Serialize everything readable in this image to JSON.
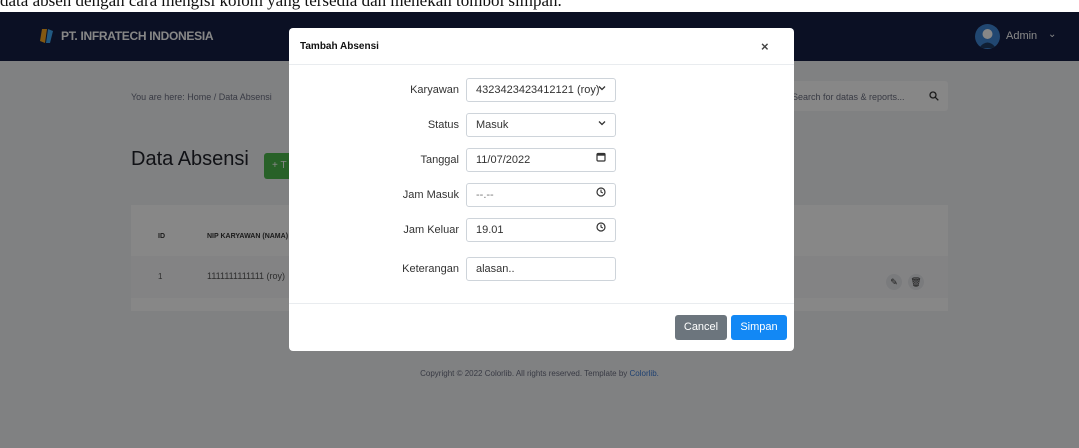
{
  "caption": "data absen dengan cara mengisi kolom yang tersedia dan menekan tombol simpan.",
  "header": {
    "brand": "PT. INFRATECH INDONESIA",
    "user": "Admin",
    "caret": "⌄"
  },
  "breadcrumb": "You are here: Home / Data Absensi",
  "search": {
    "placeholder": "Search for datas & reports..."
  },
  "page": {
    "title": "Data Absensi",
    "add_label": "+ T"
  },
  "table": {
    "headers": [
      "ID",
      "NIP KARYAWAN (NAMA)"
    ],
    "rows": [
      {
        "id": "1",
        "nip": "1111111111111 (roy)"
      }
    ]
  },
  "footer": {
    "text": "Copyright © 2022 Colorlib. All rights reserved. Template by ",
    "link": "Colorlib."
  },
  "modal": {
    "title": "Tambah Absensi",
    "close": "×",
    "fields": [
      {
        "label": "Karyawan",
        "value": "4323423423412121 (roy)",
        "icon": "chevron-down-icon"
      },
      {
        "label": "Status",
        "value": "Masuk",
        "icon": "chevron-down-icon"
      },
      {
        "label": "Tanggal",
        "value": "11/07/2022",
        "icon": "calendar-icon"
      },
      {
        "label": "Jam Masuk",
        "value": "--.--",
        "icon": "clock-icon"
      },
      {
        "label": "Jam Keluar",
        "value": "19.01",
        "icon": "clock-icon"
      },
      {
        "label": "Keterangan",
        "value": "alasan.."
      }
    ],
    "cancel_label": "Cancel",
    "save_label": "Simpan"
  },
  "colors": {
    "topbar": "#151f44",
    "primary": "#1288f5",
    "secondary": "#6c757d",
    "success": "#4cb84c"
  }
}
